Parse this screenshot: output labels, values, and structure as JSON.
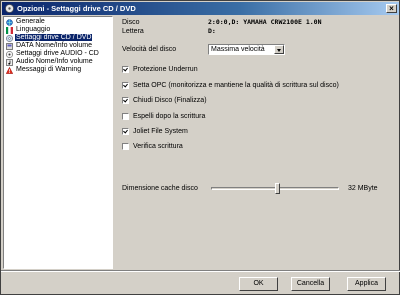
{
  "window": {
    "title": "Opzioni - Settaggi drive CD / DVD"
  },
  "sidebar": {
    "items": [
      {
        "label": "Generale",
        "icon": "globe-icon",
        "selected": false
      },
      {
        "label": "Linguaggio",
        "icon": "language-icon",
        "selected": false
      },
      {
        "label": "Settaggi drive CD / DVD",
        "icon": "cd-icon",
        "selected": true
      },
      {
        "label": "DATA Nome/Info volume",
        "icon": "data-disc-icon",
        "selected": false
      },
      {
        "label": "Settaggi drive AUDIO - CD",
        "icon": "audio-cd-icon",
        "selected": false
      },
      {
        "label": "Audio Nome/Info volume",
        "icon": "audio-note-icon",
        "selected": false
      },
      {
        "label": "Messaggi di Warning",
        "icon": "warning-icon",
        "selected": false
      }
    ]
  },
  "main": {
    "disco_label": "Disco",
    "disco_value": "2:0:0,D: YAMAHA  CRW2100E   1.0N",
    "lettera_label": "Lettera",
    "lettera_value": "D:",
    "speed_label": "Velocità del disco",
    "speed_value": "Massima velocità",
    "options": [
      {
        "label": "Protezione Underrun",
        "checked": true
      },
      {
        "label": "Setta OPC (monitorizza e mantiene la qualità di scrittura sul disco)",
        "checked": true
      },
      {
        "label": "Chiudi Disco (Finalizza)",
        "checked": true
      },
      {
        "label": "Espelli dopo la scrittura",
        "checked": false
      },
      {
        "label": "Joliet File System",
        "checked": true
      },
      {
        "label": "Verifica scrittura",
        "checked": false
      }
    ],
    "cache_label": "Dimensione cache disco",
    "cache_value": "32 MByte",
    "cache_fraction": 0.52
  },
  "buttons": {
    "ok": "OK",
    "cancel": "Cancella",
    "apply": "Applica"
  },
  "colors": {
    "title_bar": "#0a246a",
    "selection": "#0a246a",
    "face": "#d4d0c8"
  }
}
